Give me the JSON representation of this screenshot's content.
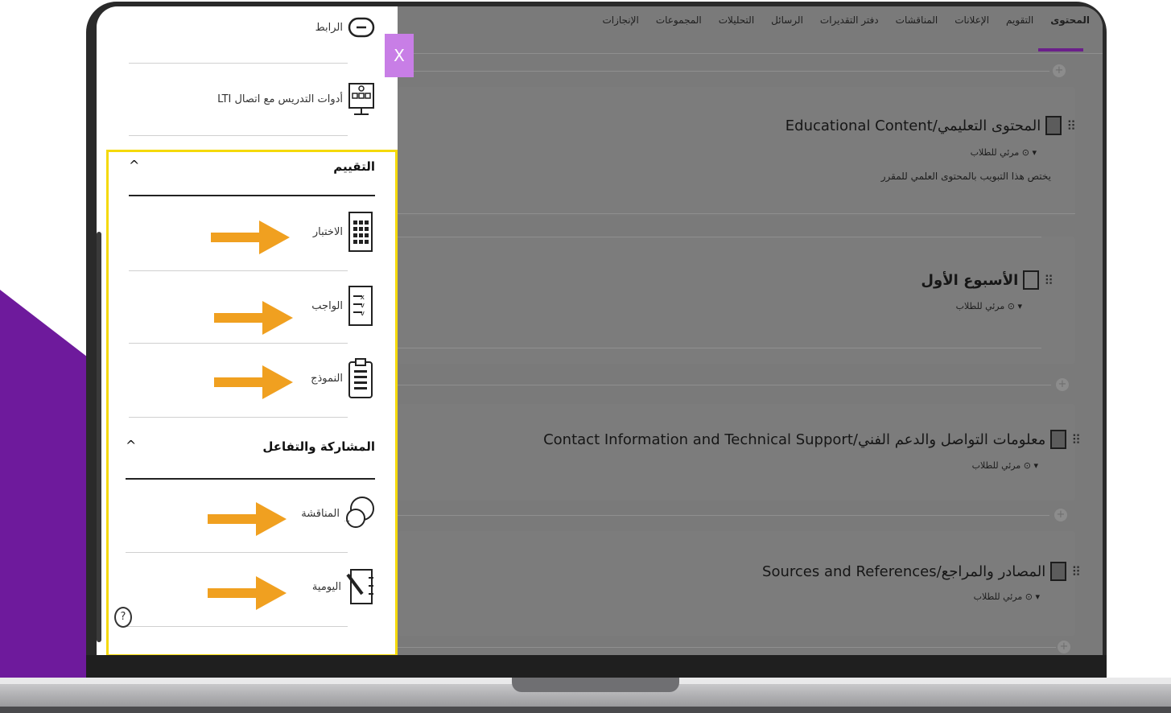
{
  "tabs": [
    "المحتوى",
    "التقويم",
    "الإعلانات",
    "المناقشات",
    "دفتر التقديرات",
    "الرسائل",
    "التحليلات",
    "المجموعات",
    "الإنجازات"
  ],
  "panel": {
    "close_label": "X",
    "top_items": [
      {
        "label": "الرابط",
        "icon": "link-icon"
      },
      {
        "label": "أدوات التدريس مع اتصال LTI",
        "icon": "lti-tools-icon"
      }
    ],
    "sections": [
      {
        "title": "التقييم",
        "caret": "^",
        "items": [
          {
            "label": "الاختبار",
            "icon": "test-icon"
          },
          {
            "label": "الواجب",
            "icon": "assignment-icon"
          },
          {
            "label": "النموذج",
            "icon": "form-icon"
          }
        ]
      },
      {
        "title": "المشاركة والتفاعل",
        "caret": "^",
        "items": [
          {
            "label": "المناقشة",
            "icon": "discussion-icon"
          },
          {
            "label": "اليومية",
            "icon": "journal-icon"
          }
        ]
      }
    ],
    "help_label": "?"
  },
  "content": {
    "visibility_label": "مرئي للطلاب",
    "items": [
      {
        "title": "المحتوى التعليمي/Educational Content",
        "description": "يختص هذا التبويب بالمحتوى العلمي للمقرر"
      },
      {
        "title": "الأسبوع الأول",
        "description": ""
      },
      {
        "title": "معلومات التواصل والدعم الفني/Contact Information and Technical Support",
        "description": ""
      },
      {
        "title": "المصادر والمراجع/Sources and References",
        "description": ""
      }
    ]
  },
  "colors": {
    "accent_purple": "#6b1f8a",
    "close_button": "#c87ee6",
    "highlight_border": "#f5d90a",
    "arrow_orange": "#f0a020"
  }
}
